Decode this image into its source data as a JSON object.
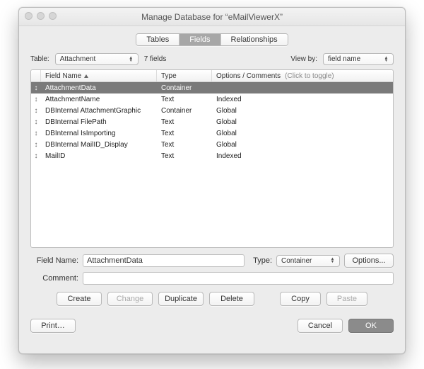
{
  "window": {
    "title": "Manage Database for “eMailViewerX”"
  },
  "tabs": {
    "tables": "Tables",
    "fields": "Fields",
    "relationships": "Relationships"
  },
  "toolbar": {
    "table_label": "Table:",
    "table_value": "Attachment",
    "field_count": "7 fields",
    "viewby_label": "View by:",
    "viewby_value": "field name"
  },
  "columns": {
    "name": "Field Name",
    "type": "Type",
    "options": "Options / Comments",
    "click_toggle": "(Click to toggle)"
  },
  "rows": [
    {
      "name": "AttachmentData",
      "type": "Container",
      "options": "",
      "selected": true
    },
    {
      "name": "AttachmentName",
      "type": "Text",
      "options": "Indexed",
      "selected": false
    },
    {
      "name": "DBInternal AttachmentGraphic",
      "type": "Container",
      "options": "Global",
      "selected": false
    },
    {
      "name": "DBInternal FilePath",
      "type": "Text",
      "options": "Global",
      "selected": false
    },
    {
      "name": "DBInternal IsImporting",
      "type": "Text",
      "options": "Global",
      "selected": false
    },
    {
      "name": "DBInternal MailID_Display",
      "type": "Text",
      "options": "Global",
      "selected": false
    },
    {
      "name": "MailID",
      "type": "Text",
      "options": "Indexed",
      "selected": false
    }
  ],
  "form": {
    "fieldname_label": "Field Name:",
    "fieldname_value": "AttachmentData",
    "type_label": "Type:",
    "type_value": "Container",
    "options_btn": "Options...",
    "comment_label": "Comment:",
    "comment_value": ""
  },
  "buttons": {
    "create": "Create",
    "change": "Change",
    "duplicate": "Duplicate",
    "delete": "Delete",
    "copy": "Copy",
    "paste": "Paste",
    "print": "Print…",
    "cancel": "Cancel",
    "ok": "OK"
  }
}
